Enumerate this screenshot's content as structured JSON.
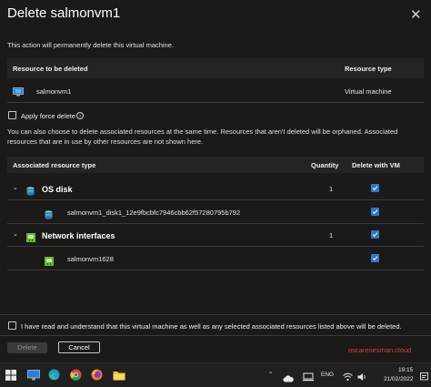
{
  "dialog": {
    "title": "Delete salmonvm1",
    "close_glyph": "✕",
    "warning": "This action will permanently delete this virtual machine."
  },
  "resource_table": {
    "headers": [
      "Resource to be deleted",
      "Resource type"
    ],
    "row": {
      "name": "salmonvm1",
      "type": "Virtual machine",
      "icon": "virtual-machine-icon"
    }
  },
  "force_delete": {
    "label": "Apply force delete",
    "checked": false,
    "info_icon": "info-icon"
  },
  "description": "You can also choose to delete associated resources at the same time. Resources that aren't deleted will be orphaned. Associated resources that are in use by other resources are not shown here.",
  "associated_table": {
    "headers": [
      "Associated resource type",
      "Quantity",
      "Delete with VM"
    ],
    "groups": [
      {
        "name": "OS disk",
        "quantity": "1",
        "checked": true,
        "icon": "disk-icon",
        "items": [
          {
            "name": "salmonvm1_disk1_12e9fbcbfc7946cbb62f57280795b792",
            "checked": true,
            "icon": "disk-icon"
          }
        ]
      },
      {
        "name": "Network interfaces",
        "quantity": "1",
        "checked": true,
        "icon": "network-interface-icon",
        "items": [
          {
            "name": "salmonvm1628",
            "checked": true,
            "icon": "network-interface-icon"
          }
        ]
      }
    ]
  },
  "acknowledge": {
    "label": "I have read and understand that this virtual machine as well as any selected associated resources listed above will be deleted.",
    "checked": false
  },
  "buttons": {
    "delete": "Delete",
    "cancel": "Cancel"
  },
  "watermark": "oscarenesman.cloud",
  "taskbar": {
    "icons": [
      "windows-start-icon",
      "monitor-icon",
      "edge-icon",
      "chrome-icon",
      "firefox-icon",
      "file-explorer-icon"
    ],
    "tray": {
      "language": "ENG",
      "time": "19:15",
      "date": "21/02/2022"
    }
  },
  "colors": {
    "accent": "#2f78c4",
    "background": "#1b1a19",
    "watermark": "#e23b3b"
  }
}
